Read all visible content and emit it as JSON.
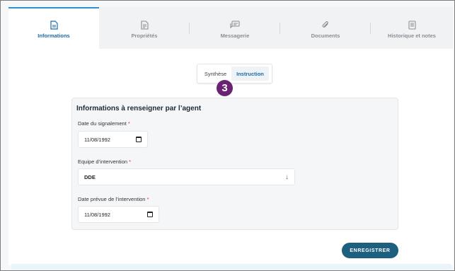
{
  "tabs": [
    {
      "label": "Informations",
      "icon": "document-icon",
      "active": true
    },
    {
      "label": "Propriétés",
      "icon": "file-list-icon",
      "active": false
    },
    {
      "label": "Messagerie",
      "icon": "chat-icon",
      "active": false
    },
    {
      "label": "Documents",
      "icon": "paperclip-icon",
      "active": false
    },
    {
      "label": "Historique et notes",
      "icon": "notes-icon",
      "active": false
    }
  ],
  "subtabs": {
    "synthese": "Synthèse",
    "instruction": "Instruction",
    "active": "Instruction"
  },
  "step_badge": "3",
  "form": {
    "title": "Informations à renseigner par l’agent",
    "date_signalement": {
      "label": "Date du signalement",
      "required_mark": "*",
      "value": "11/08/1992"
    },
    "equipe": {
      "label": "Equipe d’intervention",
      "required_mark": "*",
      "value": "DDE"
    },
    "date_prevue": {
      "label": "Date prévue de l’intervention",
      "required_mark": "*",
      "value": "11/08/1992"
    }
  },
  "save_label": "ENREGISTRER",
  "colors": {
    "accent": "#1c6aa8",
    "badge": "#6a2273",
    "button": "#1d5f7e"
  }
}
